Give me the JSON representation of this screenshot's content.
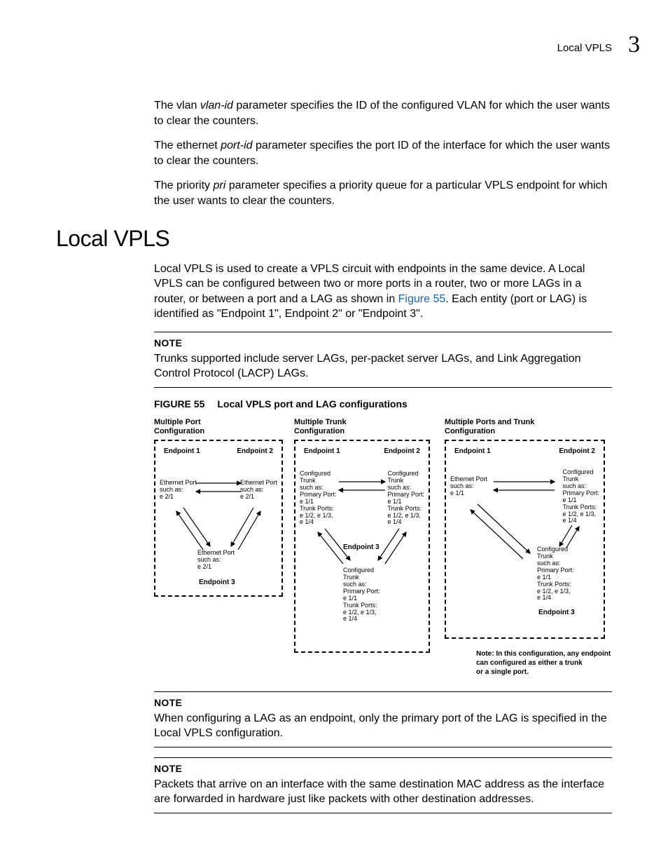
{
  "header": {
    "running_head": "Local VPLS",
    "chapter_number": "3"
  },
  "para_vlan": {
    "pre": "The vlan ",
    "em": "vlan-id",
    "post": " parameter specifies the ID of the configured VLAN for which the user wants to clear the counters."
  },
  "para_eth": {
    "pre": "The ethernet ",
    "em": "port-id",
    "post": " parameter specifies the port ID of the interface for which the user wants to clear the counters."
  },
  "para_pri": {
    "pre": "The priority ",
    "em": "pri",
    "post": " parameter specifies a priority queue for a particular VPLS endpoint for which the user wants to clear the counters."
  },
  "h1": "Local VPLS",
  "intro": {
    "pre": "Local VPLS is used to create a VPLS circuit with endpoints in the same device. A Local VPLS can be configured between two or more ports in a router, two or more LAGs in a router, or between a port and a LAG as shown in ",
    "ref": "Figure 55",
    "post": ". Each entity (port or LAG) is identified as \"Endpoint 1\", Endpoint 2\" or \"Endpoint 3\"."
  },
  "note1": {
    "label": "NOTE",
    "text": "Trunks supported include server LAGs, per-packet server LAGs, and Link Aggregation Control Protocol (LACP) LAGs."
  },
  "figcap": {
    "label": "FIGURE 55",
    "title": "Local VPLS port and LAG configurations"
  },
  "figure": {
    "footnote": "Note: In this configuration, any endpoint\n           can configured as either a trunk\n           or a single port.",
    "configA": {
      "title": "Multiple Port\nConfiguration",
      "ep1": "Endpoint 1",
      "ep2": "Endpoint 2",
      "ep3": "Endpoint 3",
      "lbl1": "Ethernet Port\nsuch as:\ne 2/1",
      "lbl2": "Ethernet Port\nsuch as:\ne 2/1",
      "lbl3": "Ethernet Port\nsuch as:\ne 2/1"
    },
    "configB": {
      "title": "Multiple Trunk\nConfiguration",
      "ep1": "Endpoint 1",
      "ep2": "Endpoint 2",
      "ep3": "Endpoint 3",
      "lbl1": "Configured\nTrunk\nsuch as:\nPrimary Port:\ne 1/1\nTrunk Ports:\ne 1/2, e 1/3,\ne 1/4",
      "lbl2": "Configured\nTrunk\nsuch as:\nPrimary Port:\ne 1/1\nTrunk Ports:\ne 1/2, e 1/3,\ne 1/4",
      "lbl3": "Configured\nTrunk\nsuch as:\nPrimary Port:\ne 1/1\nTrunk Ports:\ne 1/2, e 1/3,\ne 1/4"
    },
    "configC": {
      "title": "Multiple Ports and Trunk\nConfiguration",
      "ep1": "Endpoint 1",
      "ep2": "Endpoint 2",
      "ep3": "Endpoint 3",
      "lbl1": "Ethernet Port\nsuch as:\ne 1/1",
      "lbl2": "Configured\nTrunk\nsuch as:\nPrimary Port:\ne 1/1\nTrunk Ports:\ne 1/2, e 1/3,\ne 1/4",
      "lbl3": "Configured\nTrunk\nsuch as:\nPrimary Port:\ne 1/1\nTrunk Ports:\ne 1/2, e 1/3,\ne 1/4"
    }
  },
  "note2": {
    "label": "NOTE",
    "text": "When configuring a LAG as an endpoint, only the primary port of the LAG is specified in the Local VPLS configuration."
  },
  "note3": {
    "label": "NOTE",
    "text": "Packets that arrive on an interface with the same destination MAC address as the interface are forwarded in hardware just like packets with other destination addresses."
  }
}
